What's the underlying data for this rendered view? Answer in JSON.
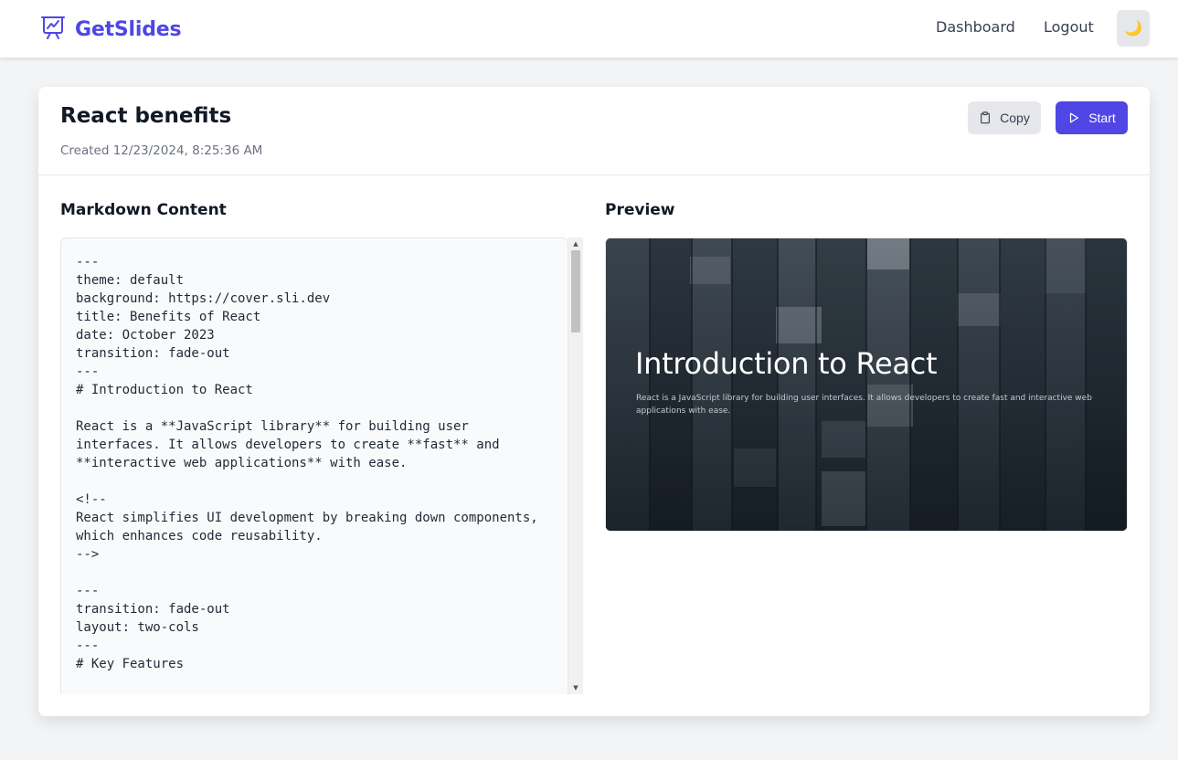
{
  "navbar": {
    "brand": "GetSlides",
    "links": {
      "dashboard": "Dashboard",
      "logout": "Logout"
    },
    "theme_icon": "moon-icon",
    "theme_glyph": "🌙"
  },
  "presentation": {
    "title": "React benefits",
    "created": "Created 12/23/2024, 8:25:36 AM",
    "actions": {
      "copy": "Copy",
      "start": "Start"
    }
  },
  "editor": {
    "heading": "Markdown Content",
    "content": "---\ntheme: default\nbackground: https://cover.sli.dev\ntitle: Benefits of React\ndate: October 2023\ntransition: fade-out\n---\n# Introduction to React\n\nReact is a **JavaScript library** for building user\ninterfaces. It allows developers to create **fast** and\n**interactive web applications** with ease.\n\n<!--\nReact simplifies UI development by breaking down components,\nwhich enhances code reusability.\n-->\n\n---\ntransition: fade-out\nlayout: two-cols\n---\n# Key Features\n"
  },
  "preview": {
    "heading": "Preview",
    "slide_title": "Introduction to React",
    "slide_text": "React is a JavaScript library for building user interfaces. It allows developers to create fast and interactive web applications with ease."
  },
  "colors": {
    "brand": "#4f46e5",
    "background": "#f3f4f6",
    "card": "#ffffff",
    "copy_button": "#e5e7eb",
    "start_button": "#4f46e5"
  }
}
